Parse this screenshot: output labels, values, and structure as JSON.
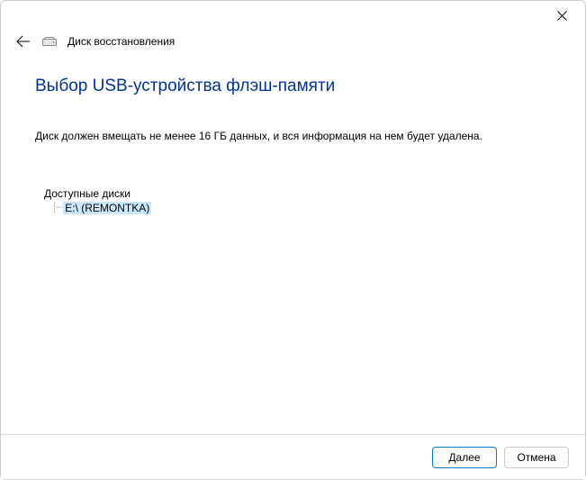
{
  "window": {
    "wizard_title": "Диск восстановления"
  },
  "page": {
    "heading": "Выбор USB-устройства флэш-памяти",
    "description": "Диск должен вмещать не менее 16 ГБ данных, и вся информация на нем будет удалена."
  },
  "drives": {
    "label": "Доступные диски",
    "items": [
      {
        "label": "E:\\ (REMONTKA)"
      }
    ]
  },
  "footer": {
    "next": "Далее",
    "cancel": "Отмена"
  }
}
